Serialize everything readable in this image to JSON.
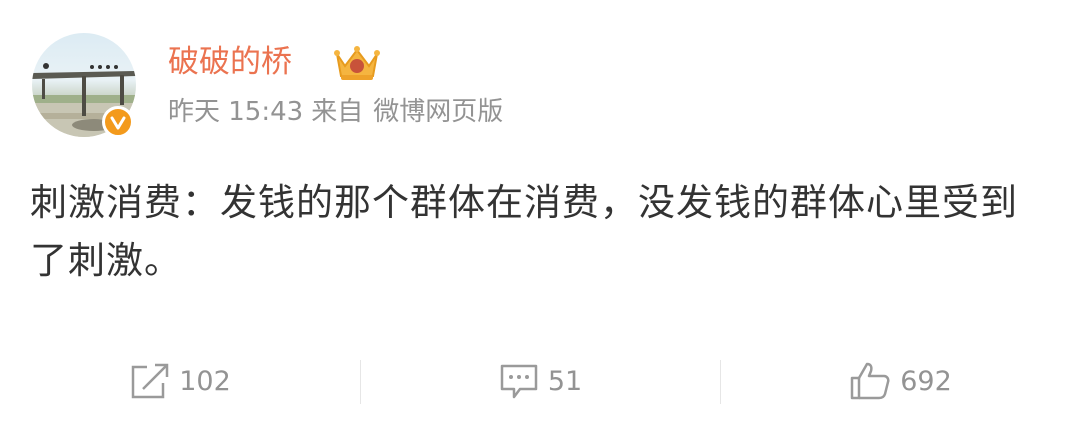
{
  "post": {
    "author": "破破的桥",
    "time": "昨天 15:43",
    "source_prefix": "来自",
    "source": "微博网页版",
    "text": "刺激消费：发钱的那个群体在消费，没发钱的群体心里受到了刺激。"
  },
  "actions": {
    "repost_count": "102",
    "comment_count": "51",
    "like_count": "692"
  },
  "icons": {
    "repost": "share-icon",
    "comment": "comment-icon",
    "like": "thumbs-up-icon",
    "badge": "crown-vip-icon",
    "verified": "verified-badge-icon"
  },
  "colors": {
    "username": "#eb7350",
    "meta": "#939393",
    "text": "#333333",
    "verified": "#f39a1c"
  }
}
